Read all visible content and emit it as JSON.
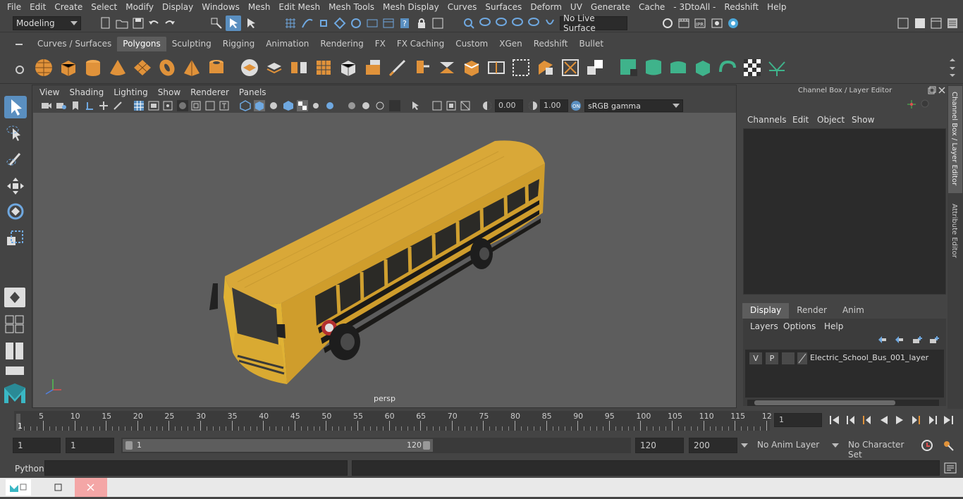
{
  "menubar": {
    "items": [
      "File",
      "Edit",
      "Create",
      "Select",
      "Modify",
      "Display",
      "Windows",
      "Mesh",
      "Edit Mesh",
      "Mesh Tools",
      "Mesh Display",
      "Curves",
      "Surfaces",
      "Deform",
      "UV",
      "Generate",
      "Cache",
      "- 3DtoAll -",
      "Redshift",
      "Help"
    ]
  },
  "statusline": {
    "mode": "Modeling",
    "live_surface": "No Live Surface"
  },
  "shelf": {
    "tabs": [
      "Curves / Surfaces",
      "Polygons",
      "Sculpting",
      "Rigging",
      "Animation",
      "Rendering",
      "FX",
      "FX Caching",
      "Custom",
      "XGen",
      "Redshift",
      "Bullet"
    ],
    "active_tab": "Polygons"
  },
  "viewport": {
    "menus": [
      "View",
      "Shading",
      "Lighting",
      "Show",
      "Renderer",
      "Panels"
    ],
    "exposure": "0.00",
    "gamma": "1.00",
    "color_space": "sRGB gamma",
    "camera": "persp"
  },
  "channelbox": {
    "title": "Channel Box / Layer Editor",
    "menus": [
      "Channels",
      "Edit",
      "Object",
      "Show"
    ],
    "layer_tabs": [
      "Display",
      "Render",
      "Anim"
    ],
    "active_layer_tab": "Display",
    "layer_menus": [
      "Layers",
      "Options",
      "Help"
    ],
    "layer": {
      "v": "V",
      "p": "P",
      "name": "Electric_School_Bus_001_layer"
    }
  },
  "side_tabs": [
    "Channel Box / Layer Editor",
    "Attribute Editor"
  ],
  "timeline": {
    "ticks": [
      "5",
      "10",
      "15",
      "20",
      "25",
      "30",
      "35",
      "40",
      "45",
      "50",
      "55",
      "60",
      "65",
      "70",
      "75",
      "80",
      "85",
      "90",
      "95",
      "100",
      "105",
      "110",
      "115",
      "12"
    ],
    "start_marker": "1",
    "current_frame": "1"
  },
  "range": {
    "start": "1",
    "playback_start": "1",
    "slider_start": "1",
    "slider_end": "120",
    "playback_end": "120",
    "end": "200",
    "anim_layer": "No Anim Layer",
    "char_set": "No Character Set"
  },
  "cmdline": {
    "label": "Python"
  },
  "colors": {
    "accent_blue": "#5a8fc0",
    "shelf_orange": "#e0923a",
    "shelf_green": "#3fb38b",
    "bus_yellow": "#e0b030"
  }
}
